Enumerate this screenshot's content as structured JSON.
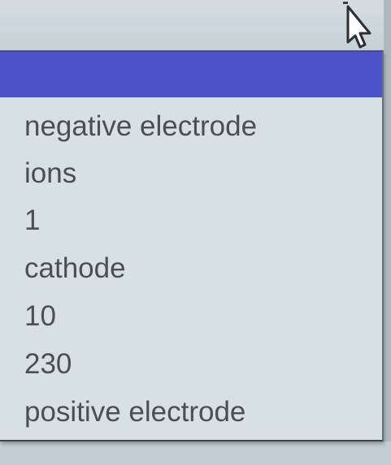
{
  "dropdown": {
    "selected_value": "",
    "options": [
      "negative electrode",
      "ions",
      "1",
      "cathode",
      "10",
      "230",
      "positive electrode"
    ]
  },
  "icons": {
    "cursor": "mouse-pointer-icon"
  },
  "colors": {
    "highlight": "#4c52c9",
    "list_background": "#d6e0e5",
    "option_text": "#4a4f55"
  }
}
